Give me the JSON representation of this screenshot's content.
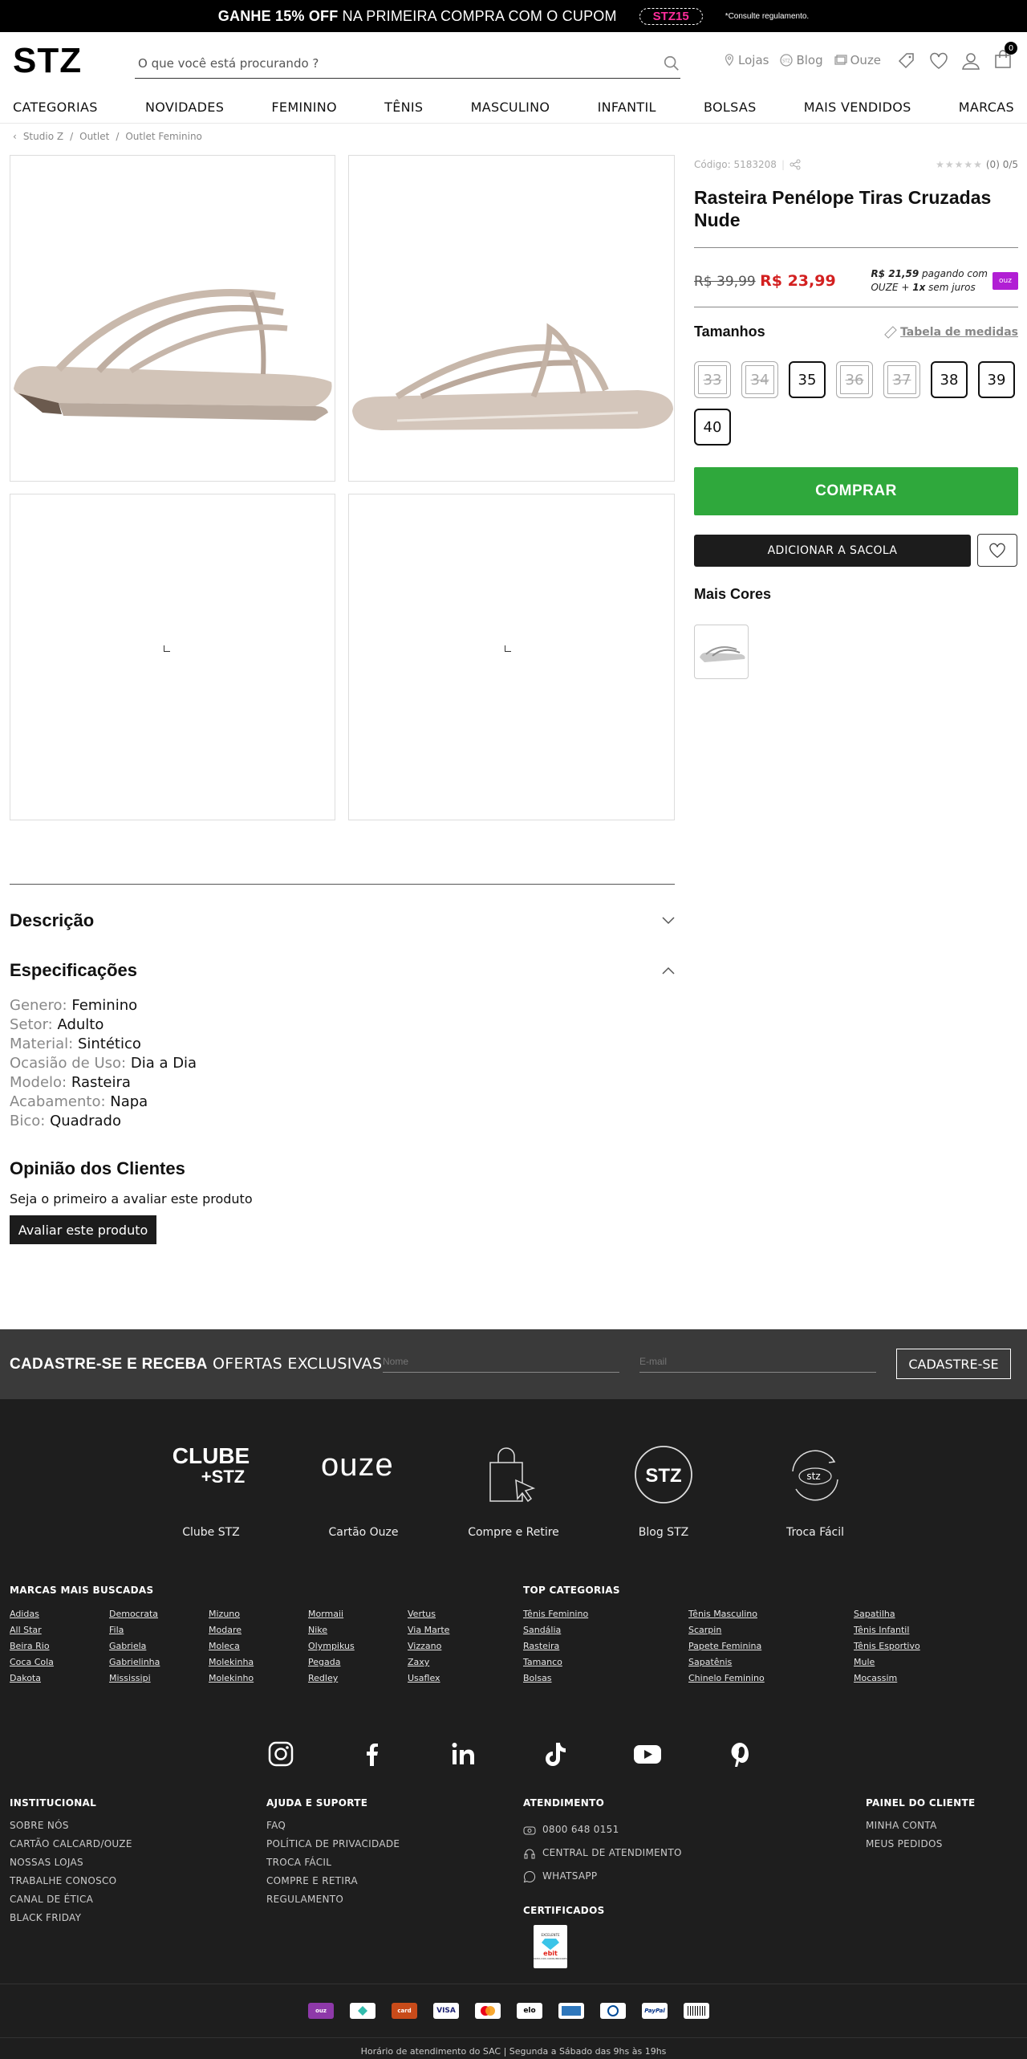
{
  "promo": {
    "text_bold": "GANHE 15% OFF",
    "text_rest": "NA PRIMEIRA COMPRA COM O CUPOM",
    "code": "STZ15",
    "note": "*Consulte regulamento."
  },
  "header": {
    "logo": "STZ",
    "search_placeholder": "O que você está procurando ?",
    "links": [
      "Lojas",
      "Blog",
      "Ouze"
    ],
    "bag_count": "0"
  },
  "nav": [
    "CATEGORIAS",
    "NOVIDADES",
    "FEMININO",
    "TÊNIS",
    "MASCULINO",
    "INFANTIL",
    "BOLSAS",
    "MAIS VENDIDOS",
    "MARCAS"
  ],
  "breadcrumb": [
    "Studio Z",
    "Outlet",
    "Outlet Feminino"
  ],
  "product": {
    "code": "Código: 5183208",
    "rating": "(0) 0/5",
    "title": "Rasteira Penélope Tiras Cruzadas Nude",
    "old_price": "R$ 39,99",
    "price": "R$ 23,99",
    "ouze_price": "R$ 21,59",
    "ouze_line1": "pagando com",
    "ouze_line2": "OUZE +",
    "ouze_inst": "1x",
    "ouze_line3": "sem juros",
    "ouze_badge": "ouz",
    "sizes_label": "Tamanhos",
    "size_chart": "Tabela de medidas",
    "sizes": [
      {
        "n": "33",
        "available": false
      },
      {
        "n": "34",
        "available": false
      },
      {
        "n": "35",
        "available": true
      },
      {
        "n": "36",
        "available": false
      },
      {
        "n": "37",
        "available": false
      },
      {
        "n": "38",
        "available": true
      },
      {
        "n": "39",
        "available": true
      },
      {
        "n": "40",
        "available": true
      }
    ],
    "buy": "COMPRAR",
    "add_bag": "ADICIONAR A SACOLA",
    "more_colors": "Mais Cores"
  },
  "description_title": "Descrição",
  "specs_title": "Especificações",
  "specs": [
    {
      "k": "Genero:",
      "v": "Feminino"
    },
    {
      "k": "Setor:",
      "v": "Adulto"
    },
    {
      "k": "Material:",
      "v": "Sintético"
    },
    {
      "k": "Ocasião de Uso:",
      "v": "Dia a Dia"
    },
    {
      "k": "Modelo:",
      "v": "Rasteira"
    },
    {
      "k": "Acabamento:",
      "v": "Napa"
    },
    {
      "k": "Bico:",
      "v": "Quadrado"
    }
  ],
  "reviews": {
    "title": "Opinião dos Clientes",
    "empty": "Seja o primeiro a avaliar este produto",
    "button": "Avaliar este produto"
  },
  "newsletter": {
    "bold": "CADASTRE-SE E RECEBA",
    "rest": "OFERTAS EXCLUSIVAS",
    "name_ph": "Nome",
    "email_ph": "E-mail",
    "button": "CADASTRE-SE"
  },
  "features": [
    {
      "label": "Clube STZ",
      "art1": "CLUBE",
      "art2": "+STZ"
    },
    {
      "label": "Cartão Ouze",
      "art1": "ouze"
    },
    {
      "label": "Compre e Retire"
    },
    {
      "label": "Blog STZ",
      "art1": "STZ"
    },
    {
      "label": "Troca Fácil",
      "art1": "stz"
    }
  ],
  "brands_title": "MARCAS MAIS BUSCADAS",
  "brands": [
    [
      "Adidas",
      "All Star",
      "Beira Rio",
      "Coca Cola",
      "Dakota"
    ],
    [
      "Democrata",
      "Fila",
      "Gabriela",
      "Gabrielinha",
      "Mississipi"
    ],
    [
      "Mizuno",
      "Modare",
      "Moleca",
      "Molekinha",
      "Molekinho"
    ],
    [
      "Mormaii",
      "Nike",
      "Olympikus",
      "Pegada",
      "Redley"
    ],
    [
      "Vertus",
      "Via Marte",
      "Vizzano",
      "Zaxy",
      "Usaflex"
    ]
  ],
  "topcat_title": "TOP CATEGORIAS",
  "topcats": [
    [
      "Tênis Feminino",
      "Sandália",
      "Rasteira",
      "Tamanco",
      "Bolsas"
    ],
    [
      "Tênis Masculino",
      "Scarpin",
      "Papete Feminina",
      "Sapatênis",
      "Chinelo Feminino"
    ],
    [
      "Sapatilha",
      "Tênis Infantil",
      "Tênis Esportivo",
      "Mule",
      "Mocassim"
    ]
  ],
  "institucional": {
    "title": "INSTITUCIONAL",
    "items": [
      "SOBRE NÓS",
      "CARTÃO CALCARD/OUZE",
      "NOSSAS LOJAS",
      "TRABALHE CONOSCO",
      "CANAL DE ÉTICA",
      "BLACK FRIDAY"
    ]
  },
  "ajuda": {
    "title": "AJUDA E SUPORTE",
    "items": [
      "FAQ",
      "POLÍTICA DE PRIVACIDADE",
      "TROCA FÁCIL",
      "COMPRE E RETIRA",
      "REGULAMENTO"
    ]
  },
  "atendimento": {
    "title": "ATENDIMENTO",
    "items": [
      "0800 648 0151",
      "CENTRAL DE ATENDIMENTO",
      "WHATSAPP"
    ]
  },
  "certificados": {
    "title": "CERTIFICADOS",
    "badge_top": "EXCELENTE",
    "badge_name": "ebit",
    "badge_sub": "NOTA DOS CONSUMIDORES"
  },
  "painel": {
    "title": "PAINEL DO CLIENTE",
    "items": [
      "MINHA CONTA",
      "MEUS PEDIDOS"
    ]
  },
  "payments": [
    "ouz",
    "boleto",
    "card",
    "VISA",
    "mc",
    "elo",
    "amex",
    "diners",
    "PayPal",
    "bar"
  ],
  "sac": "Horário de atendimento do SAC | Segunda a Sábado das 9hs às 19hs",
  "colors": {
    "accent_green": "#2fa83c",
    "price_red": "#d32020",
    "ouze_pink": "#e91ecf"
  }
}
